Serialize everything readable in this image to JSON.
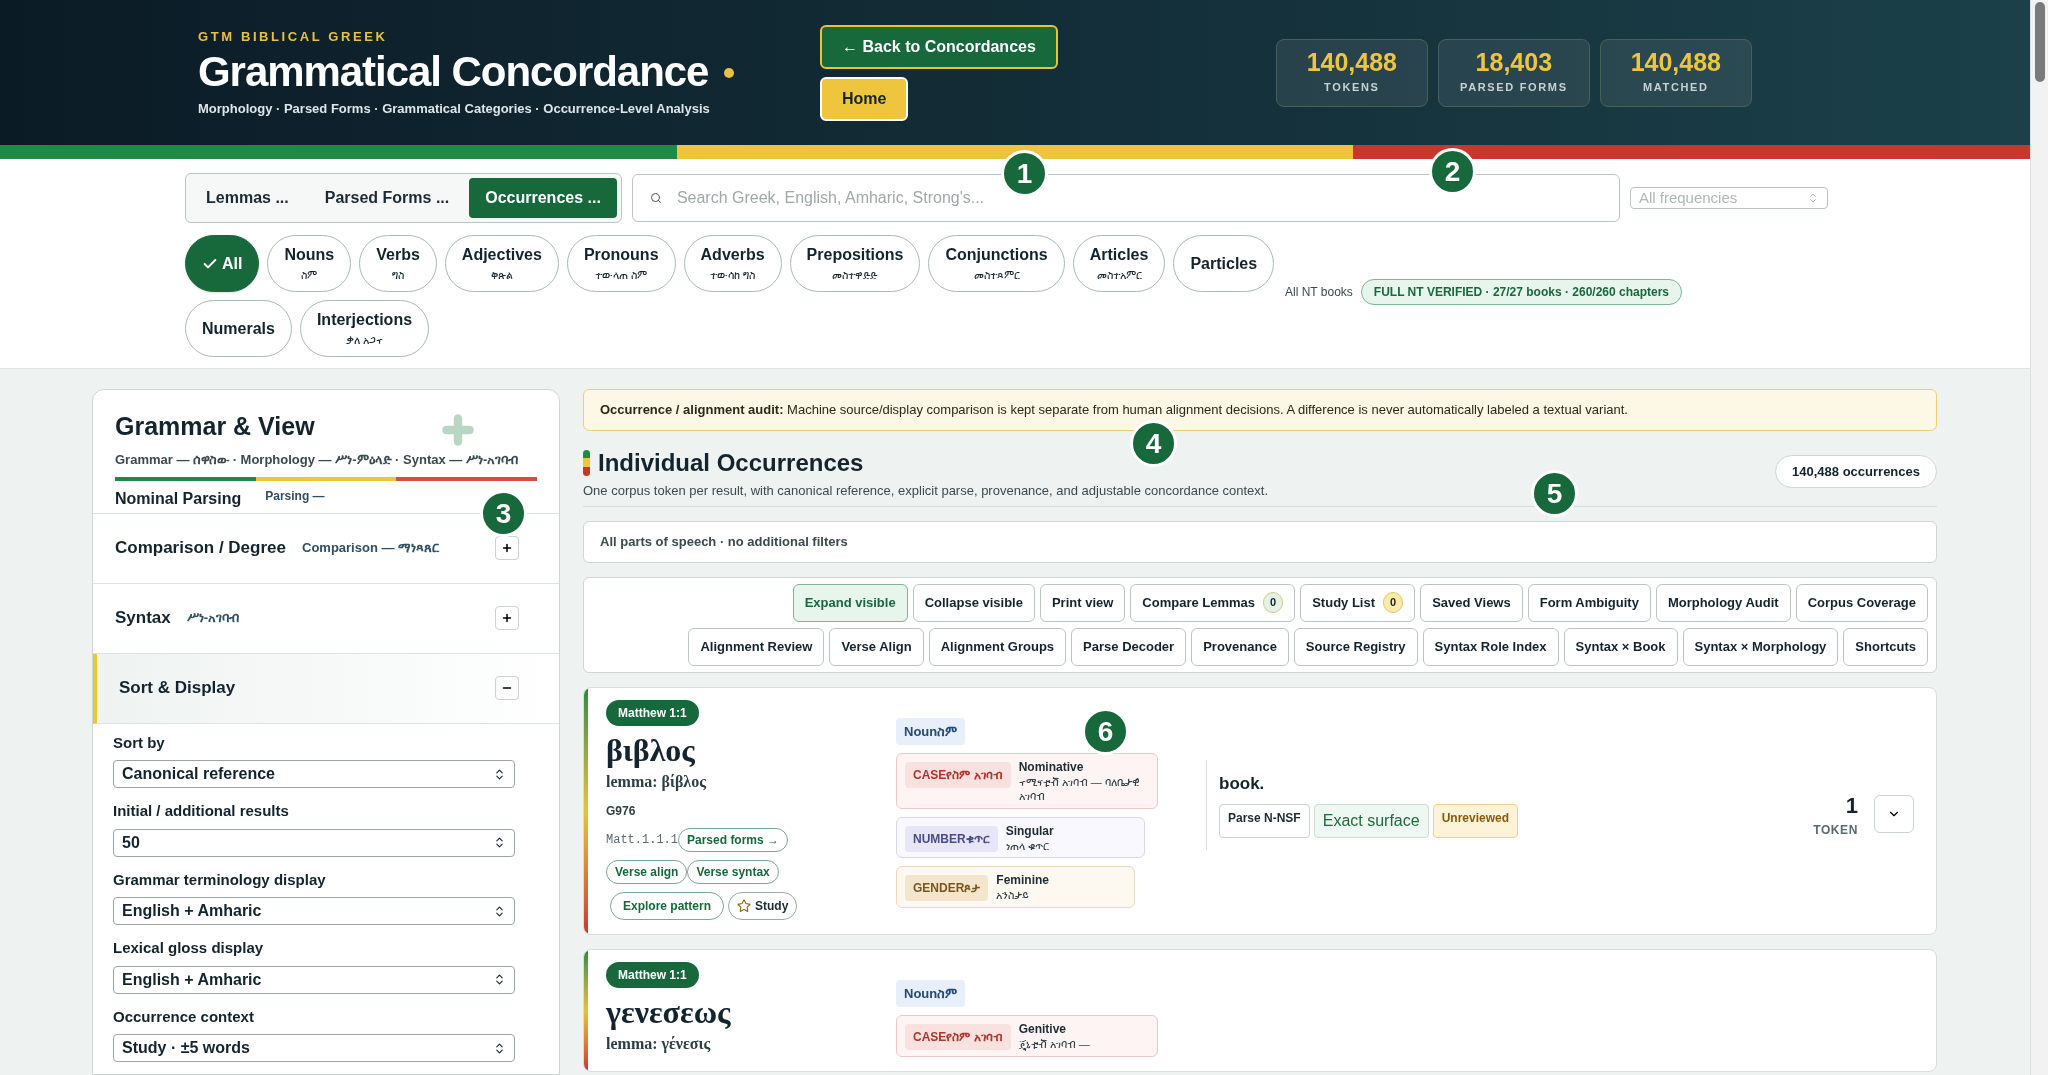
{
  "header": {
    "eyebrow": "GTM BIBLICAL GREEK",
    "title": "Grammatical Concordance",
    "subtitle": "Morphology · Parsed Forms · Grammatical Categories · Occurrence-Level Analysis",
    "back_button": "← Back to Concordances",
    "home_button": "Home",
    "stats": [
      {
        "value": "140,488",
        "label": "TOKENS"
      },
      {
        "value": "18,403",
        "label": "PARSED FORMS"
      },
      {
        "value": "140,488",
        "label": "MATCHED"
      }
    ]
  },
  "view_tabs": [
    {
      "label": "Lemmas",
      "count": "...",
      "selected": false
    },
    {
      "label": "Parsed Forms",
      "count": "...",
      "selected": false
    },
    {
      "label": "Occurrences",
      "count": "...",
      "selected": true
    }
  ],
  "search": {
    "placeholder": "Search Greek, English, Amharic, Strong's..."
  },
  "frequency_select": {
    "placeholder": "All frequencies"
  },
  "pos_chips": [
    {
      "label": "All",
      "selected": true
    },
    {
      "label": "Nouns",
      "amharic": "ስም",
      "selected": false
    },
    {
      "label": "Verbs",
      "amharic": "ግስ",
      "selected": false
    },
    {
      "label": "Adjectives",
      "amharic": "ቅጽል",
      "selected": false
    },
    {
      "label": "Pronouns",
      "amharic": "ተውላጠ ስም",
      "selected": false
    },
    {
      "label": "Adverbs",
      "amharic": "ተውሳከ ግስ",
      "selected": false
    },
    {
      "label": "Prepositions",
      "amharic": "መስተዋድድ",
      "selected": false
    },
    {
      "label": "Conjunctions",
      "amharic": "መስተጻምር",
      "selected": false
    },
    {
      "label": "Articles",
      "amharic": "መስተአምር",
      "selected": false
    },
    {
      "label": "Particles",
      "selected": false
    },
    {
      "label": "Numerals",
      "selected": false
    },
    {
      "label": "Interjections",
      "amharic": "ቃለ አጋኖ",
      "selected": false
    }
  ],
  "coverage": {
    "label": "All NT books",
    "badge": "FULL NT VERIFIED · 27/27 books · 260/260 chapters"
  },
  "markers": [
    "1",
    "2",
    "3",
    "4",
    "5",
    "6"
  ],
  "sidebar": {
    "title": "Grammar & View",
    "subtitle": "Grammar — ሰዋስው · Morphology — ሥነ-ምዕላድ · Syntax — ሥነ-አገባብ",
    "sections": [
      {
        "title": "Nominal Parsing",
        "gloss": "Parsing —",
        "kind": "partial"
      },
      {
        "title": "Comparison / Degree",
        "gloss": "Comparison — ማነጻጸር",
        "expanded": false,
        "kind": "full"
      },
      {
        "title": "Syntax",
        "gloss": "ሥነ-አገባብ",
        "expanded": false,
        "kind": "full"
      },
      {
        "title": "Sort & Display",
        "expanded": true,
        "kind": "full"
      }
    ],
    "settings": [
      {
        "label": "Sort by",
        "value": "Canonical reference"
      },
      {
        "label": "Initial / additional results",
        "value": "50"
      },
      {
        "label": "Grammar terminology display",
        "value": "English + Amharic"
      },
      {
        "label": "Lexical gloss display",
        "value": "English + Amharic"
      },
      {
        "label": "Occurrence context",
        "value": "Study · ±5 words"
      }
    ]
  },
  "audit": "**Occurrence / alignment audit:** Machine source/display comparison is kept separate from human alignment decisions. A difference is never automatically labeled a textual variant.",
  "results": {
    "title": "Individual Occurrences",
    "description": "One corpus token per result, with canonical reference, explicit parse, provenance, and adjustable concordance context.",
    "count": "140,488 occurrences",
    "filter_summary": "All parts of speech · no additional filters"
  },
  "toolbar": [
    [
      {
        "label": "Expand visible",
        "selected": true
      },
      {
        "label": "Collapse visible",
        "selected": false
      },
      {
        "label": "Print view",
        "selected": false
      },
      {
        "label": "Compare Lemmas",
        "count": "0",
        "color": "#e3f1e8",
        "selected": false
      },
      {
        "label": "Study List",
        "count": "0",
        "color": "#fbeaa8",
        "selected": false
      },
      {
        "label": "Saved Views",
        "selected": false
      },
      {
        "label": "Form Ambiguity",
        "selected": false
      },
      {
        "label": "Morphology Audit",
        "selected": false
      },
      {
        "label": "Corpus Coverage",
        "selected": false
      }
    ],
    [
      {
        "label": "Alignment Review",
        "selected": false
      },
      {
        "label": "Verse Align",
        "selected": false
      },
      {
        "label": "Alignment Groups",
        "selected": false
      },
      {
        "label": "Parse Decoder",
        "selected": false
      },
      {
        "label": "Provenance",
        "selected": false
      },
      {
        "label": "Source Registry",
        "selected": false
      },
      {
        "label": "Syntax Role Index",
        "selected": false
      },
      {
        "label": "Syntax × Book",
        "selected": false
      },
      {
        "label": "Syntax × Morphology",
        "selected": false
      },
      {
        "label": "Shortcuts",
        "selected": false
      }
    ]
  ],
  "occurrences": [
    {
      "reference": "Matthew 1:1",
      "word": "βιβλος",
      "lemma": "lemma: βίβλος",
      "strongs": "G976",
      "ref_code": "Matt.1.1.1",
      "parsed_forms_link": "Parsed forms →",
      "actions": [
        "Verse align",
        "Verse syntax"
      ],
      "explore": "Explore pattern",
      "study": "Study",
      "pos": "Noun",
      "pos_amharic": "ስም",
      "features": [
        {
          "kind": "case",
          "label": "CASE",
          "label_amharic": "የስም አገባብ",
          "value": "Nominative",
          "value_amharic": "ኖሚናቲቭ አገባብ — ባለቤታዊ አገባብ"
        },
        {
          "kind": "number",
          "label": "NUMBER",
          "label_amharic": "ቁጥር",
          "value": "Singular",
          "value_amharic": "ነጠላ ቁጥር"
        },
        {
          "kind": "gender",
          "label": "GENDER",
          "label_amharic": "ጾታ",
          "value": "Feminine",
          "value_amharic": "አንስታይ"
        }
      ],
      "gloss": "book.",
      "tags": [
        {
          "kind": "parse",
          "label": "Parse N-NSF"
        },
        {
          "kind": "exact",
          "label": "Exact surface"
        },
        {
          "kind": "review",
          "label": "Unreviewed"
        }
      ],
      "token_count": "1",
      "token_label": "TOKEN"
    },
    {
      "reference": "Matthew 1:1",
      "word": "γενεσεως",
      "lemma": "lemma: γένεσις",
      "pos": "Noun",
      "pos_amharic": "ስም",
      "features": [
        {
          "kind": "case",
          "label": "CASE",
          "label_amharic": "የስም አገባብ",
          "value": "Genitive",
          "value_amharic": "ጄኒቲቭ አገባብ —"
        }
      ]
    }
  ]
}
